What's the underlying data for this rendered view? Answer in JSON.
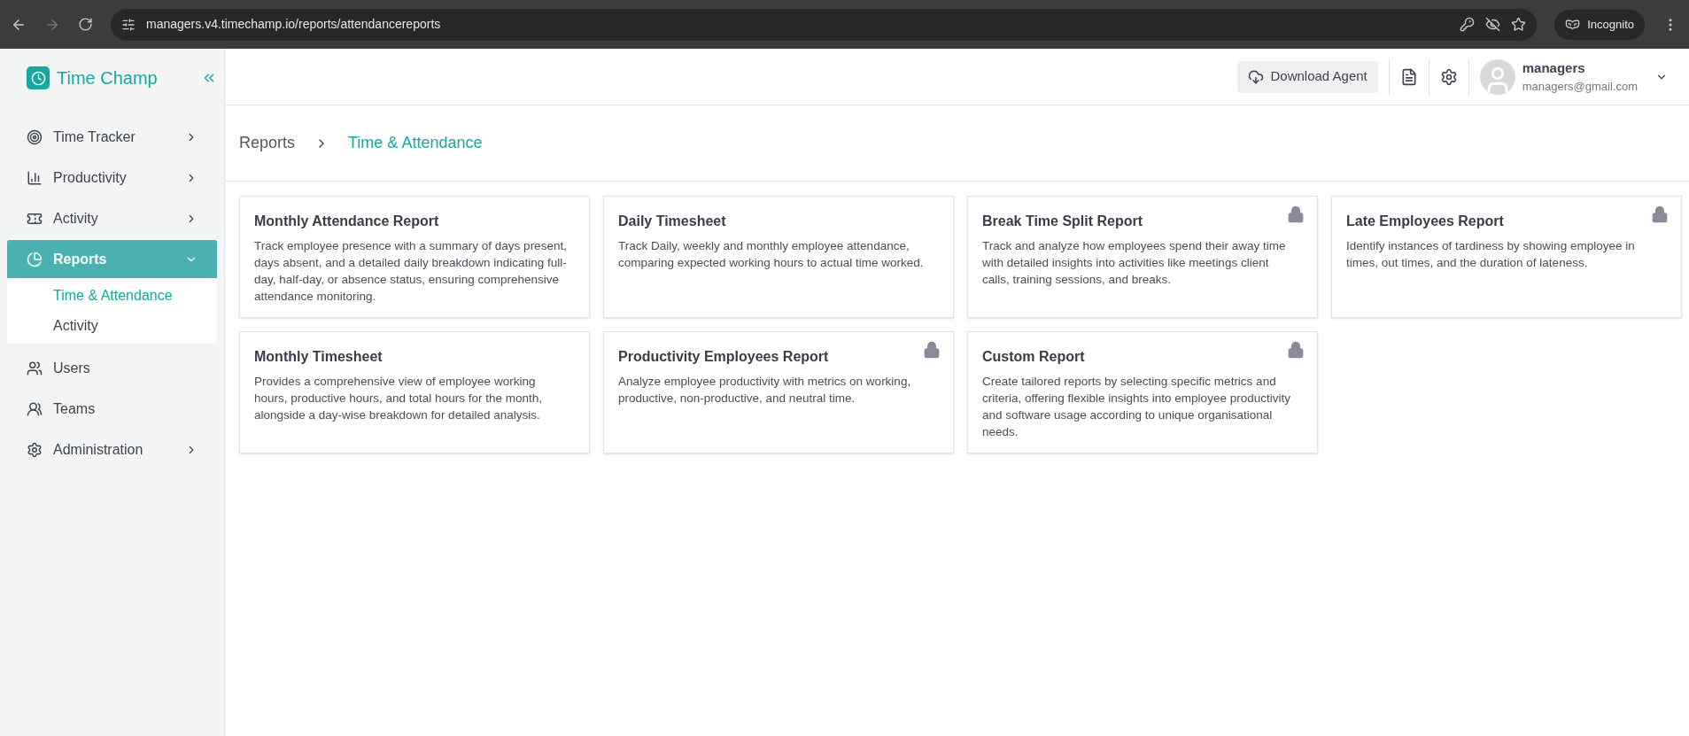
{
  "browser": {
    "url": "managers.v4.timechamp.io/reports/attendancereports",
    "mode_label": "Incognito"
  },
  "brand": {
    "name": "Time Champ"
  },
  "sidebar": {
    "items": [
      {
        "label": "Time Tracker",
        "expandable": true,
        "selected": false
      },
      {
        "label": "Productivity",
        "expandable": true,
        "selected": false
      },
      {
        "label": "Activity",
        "expandable": true,
        "selected": false
      },
      {
        "label": "Reports",
        "expandable": true,
        "expanded": true,
        "selected": true,
        "children": [
          {
            "label": "Time & Attendance",
            "selected": true
          },
          {
            "label": "Activity",
            "selected": false
          }
        ]
      },
      {
        "label": "Users",
        "expandable": false,
        "selected": false
      },
      {
        "label": "Teams",
        "expandable": false,
        "selected": false
      },
      {
        "label": "Administration",
        "expandable": true,
        "selected": false
      }
    ]
  },
  "header": {
    "download_button": "Download Agent",
    "user": {
      "name": "managers",
      "email": "managers@gmail.com"
    }
  },
  "breadcrumb": [
    "Reports",
    "Time & Attendance"
  ],
  "cards": [
    {
      "title": "Monthly Attendance Report",
      "description": "Track employee presence with a summary of days present, days absent, and a detailed daily breakdown indicating full-day, half-day, or absence status, ensuring comprehensive attendance monitoring.",
      "locked": false
    },
    {
      "title": "Daily Timesheet",
      "description": "Track Daily, weekly and monthly employee attendance, comparing expected working hours to actual time worked.",
      "locked": false
    },
    {
      "title": "Break Time Split Report",
      "description": "Track and analyze how employees spend their away time with detailed insights into activities like meetings client calls, training sessions, and breaks.",
      "locked": true
    },
    {
      "title": "Late Employees Report",
      "description": "Identify instances of tardiness by showing employee in times, out times, and the duration of lateness.",
      "locked": true
    },
    {
      "title": "Monthly Timesheet",
      "description": "Provides a comprehensive view of employee working hours, productive hours, and total hours for the month, alongside a day-wise breakdown for detailed analysis.",
      "locked": false
    },
    {
      "title": "Productivity Employees Report",
      "description": "Analyze employee productivity with metrics on working, productive, non-productive, and neutral time.",
      "locked": true
    },
    {
      "title": "Custom Report",
      "description": "Create tailored reports by selecting specific metrics and criteria, offering flexible insights into employee productivity and software usage according to unique organisational needs.",
      "locked": true
    }
  ]
}
